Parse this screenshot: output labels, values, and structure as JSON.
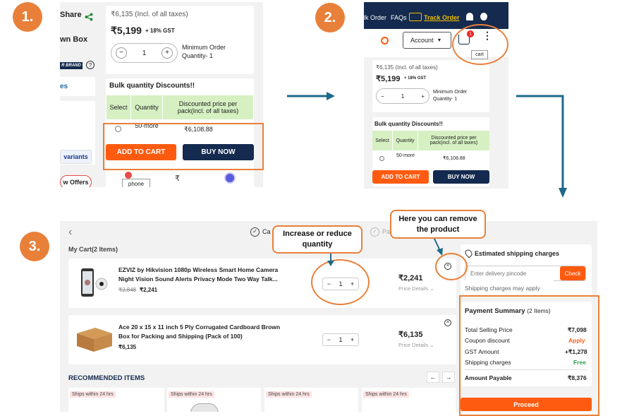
{
  "steps": {
    "one": "1.",
    "two": "2.",
    "three": "3."
  },
  "panel1": {
    "share_label": "Share",
    "product_title_fragment": "wn Box",
    "brand_badge": "R BRAND",
    "side_tab": "es",
    "variants_label": "variants",
    "offers_label": "w Offers",
    "mrp_text": "₹6,135 (Incl. of all taxes)",
    "price": "₹5,199",
    "gst": "+ 18% GST",
    "qty_minus": "−",
    "qty_value": "1",
    "qty_plus": "+",
    "min_order": "Minimum Order Quantity- 1",
    "bulk_title": "Bulk quantity Discounts!!",
    "table_headers": [
      "Select",
      "Quantity",
      "Discounted price per pack(incl. of all taxes)"
    ],
    "table_row": {
      "quantity": "50-more",
      "price": "₹6,108.88"
    },
    "add_to_cart": "ADD TO CART",
    "buy_now": "BUY NOW",
    "phone_tooltip": "phone"
  },
  "panel2": {
    "nav_items": [
      "lk Order",
      "FAQs",
      "Track Order"
    ],
    "account_label": "Account",
    "cart_badge": "1",
    "cart_tooltip": "cart",
    "mrp_text": "₹6,135 (Incl. of all taxes)",
    "price": "₹5,199",
    "gst": "+ 18% GST",
    "qty_minus": "−",
    "qty_value": "1",
    "qty_plus": "+",
    "min_order": "Minimum Order Quantity- 1",
    "bulk_title": "Bulk quantity Discounts!!",
    "table_headers": [
      "Select",
      "Quantity",
      "Discounted price per pack(incl. of all taxes)"
    ],
    "table_row": {
      "quantity": "50-more",
      "price": "₹6,108.88"
    },
    "add_to_cart": "ADD TO CART",
    "buy_now": "BUY NOW"
  },
  "panel3": {
    "stepper_cart": "Ca",
    "stepper_next": "Pa",
    "my_cart": "My Cart(2 Items)",
    "items": [
      {
        "title_line1": "EZVIZ by Hikvision 1080p Wireless Smart Home Camera",
        "title_line2": "Night Vision Sound Alerts Privacy Mode Two Way Talk...",
        "mrp": "₹2,848",
        "price": "₹2,241",
        "qty": "1",
        "total": "₹2,241",
        "details": "Price Details"
      },
      {
        "title_line1": "Ace 20 x 15 x 11 inch 5 Ply Corrugated Cardboard Brown",
        "title_line2": "Box for Packing and Shipping (Pack of 100)",
        "price": "₹6,135",
        "qty": "1",
        "total": "₹6,135",
        "details": "Price Details"
      }
    ],
    "recommended_title": "RECOMMENDED ITEMS",
    "ships_label": "Ships within 24 hrs",
    "shipping": {
      "title": "Estimated shipping charges",
      "placeholder": "Enter delivery pincode",
      "check": "Check",
      "note": "Shipping charges may apply"
    },
    "summary": {
      "title": "Payment Summary",
      "count": "(2 Items)",
      "rows": [
        {
          "label": "Total Selling Price",
          "value": "₹7,098"
        },
        {
          "label": "Coupon discount",
          "value": "Apply"
        },
        {
          "label": "GST Amount",
          "value": "+₹1,278"
        },
        {
          "label": "Shipping charges",
          "value": "Free"
        }
      ],
      "payable_label": "Amount Payable",
      "payable_value": "₹8,376",
      "proceed": "Proceed"
    }
  },
  "callouts": {
    "remove": "Here you can remove the product",
    "quantity": "Increase or reduce quantity"
  },
  "colors": {
    "accent": "#e8803a",
    "orange_btn": "#ff5b10",
    "navy": "#142a4e",
    "arrow": "#1f6a8a",
    "green": "#2da44e"
  }
}
